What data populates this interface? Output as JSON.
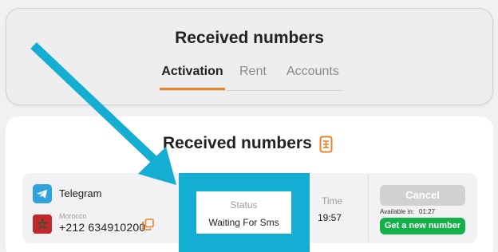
{
  "header": {
    "title": "Received numbers",
    "tabs": [
      {
        "label": "Activation",
        "active": true
      },
      {
        "label": "Rent",
        "active": false
      },
      {
        "label": "Accounts",
        "active": false
      }
    ]
  },
  "main": {
    "title": "Received numbers",
    "row": {
      "service": "Telegram",
      "country": "Morocco",
      "phone": "+212 634910200",
      "status_label": "Status",
      "status_value": "Waiting For Sms",
      "time_label": "Time",
      "time_value": "19:57",
      "cancel_label": "Cancel",
      "available_label": "Available in:",
      "available_time": "01:27",
      "new_number_label": "Get a new number"
    }
  },
  "colors": {
    "accent": "#e8842a",
    "highlight": "#13aed1",
    "success": "#16b04b",
    "telegram": "#2fa3dd"
  },
  "icons": [
    "document-icon",
    "telegram-icon",
    "morocco-flag-icon",
    "copy-icon",
    "arrow-annotation"
  ]
}
